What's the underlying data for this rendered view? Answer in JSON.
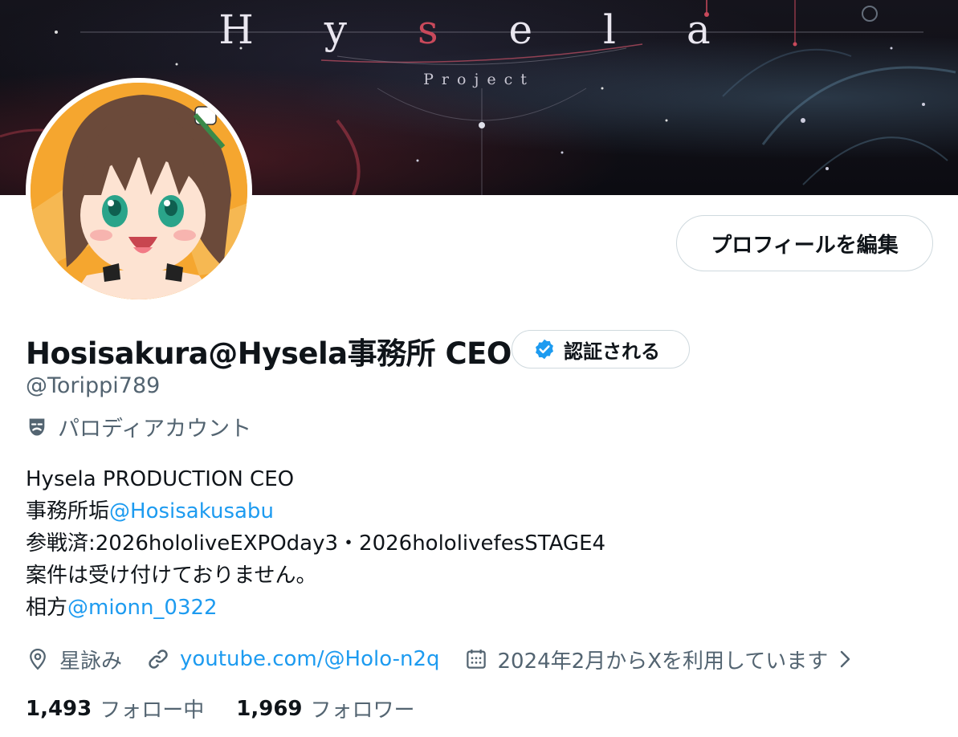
{
  "banner": {
    "title_part1": "H y ",
    "title_red": "s",
    "title_part2": " e l a",
    "subtitle": "Project"
  },
  "profile": {
    "edit_button_label": "プロフィールを編集",
    "display_name": "Hosisakura@Hysela事務所 CEO",
    "verify_label": "認証される",
    "handle": "@Torippi789",
    "parody_label": "パロディアカウント",
    "bio": {
      "line1": "Hysela PRODUCTION CEO",
      "line2_prefix": "事務所垢",
      "line2_link": "@Hosisakusabu",
      "line3": "参戦済:2026hololiveEXPOday3・2026hololivefesSTAGE4",
      "line4": "案件は受け付けておりません。",
      "line5_prefix": "相方",
      "line5_link": "@mionn_0322"
    },
    "meta": {
      "location": "星詠み",
      "website": "youtube.com/@Holo-n2q",
      "joined": "2024年2月からXを利用しています"
    },
    "stats": {
      "following_count": "1,493",
      "following_label": "フォロー中",
      "followers_count": "1,969",
      "followers_label": "フォロワー"
    }
  },
  "colors": {
    "link": "#1d9bf0",
    "secondary_text": "#536471",
    "primary_text": "#0f1419",
    "verified": "#1d9bf0",
    "border": "#cfd9de"
  },
  "icons": [
    "verified-check-icon",
    "parody-mask-icon",
    "location-pin-icon",
    "link-icon",
    "calendar-icon",
    "chevron-right-icon"
  ]
}
